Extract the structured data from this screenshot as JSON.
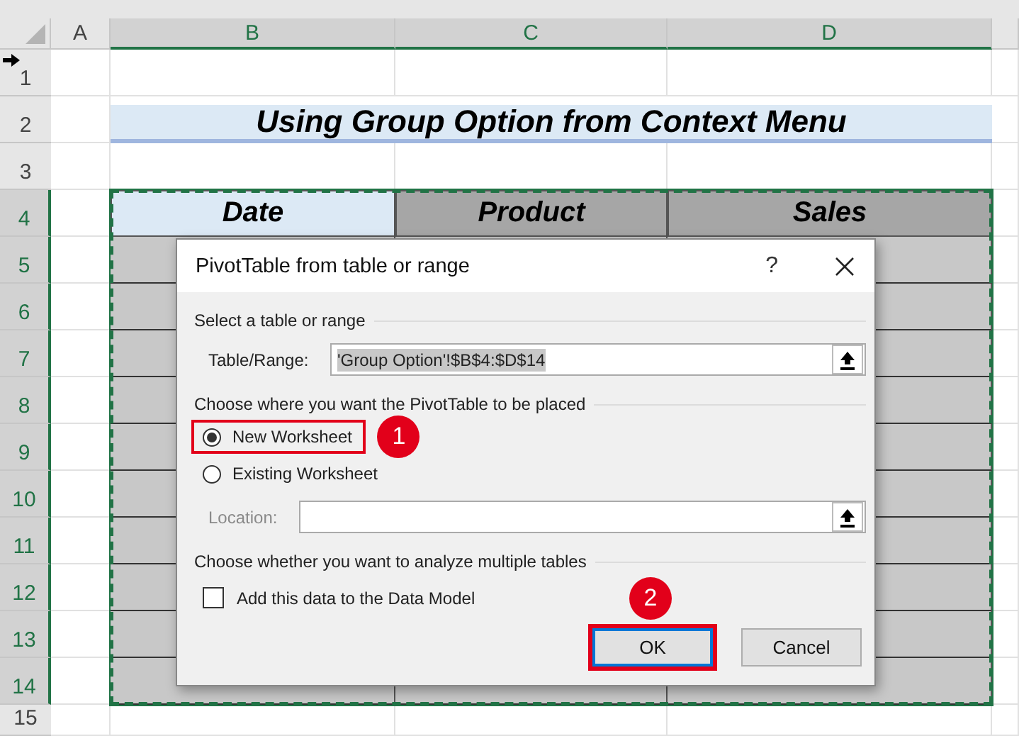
{
  "sheet": {
    "columns": [
      {
        "label": "A",
        "selected": false
      },
      {
        "label": "B",
        "selected": true
      },
      {
        "label": "C",
        "selected": true
      },
      {
        "label": "D",
        "selected": true
      }
    ],
    "rows": [
      {
        "label": "1",
        "selected": false
      },
      {
        "label": "2",
        "selected": false
      },
      {
        "label": "3",
        "selected": false
      },
      {
        "label": "4",
        "selected": true
      },
      {
        "label": "5",
        "selected": true
      },
      {
        "label": "6",
        "selected": true
      },
      {
        "label": "7",
        "selected": true
      },
      {
        "label": "8",
        "selected": true
      },
      {
        "label": "9",
        "selected": true
      },
      {
        "label": "10",
        "selected": true
      },
      {
        "label": "11",
        "selected": true
      },
      {
        "label": "12",
        "selected": true
      },
      {
        "label": "13",
        "selected": true
      },
      {
        "label": "14",
        "selected": true
      },
      {
        "label": "15",
        "selected": false
      }
    ],
    "title": "Using Group Option from Context Menu",
    "table_headers": [
      {
        "label": "Date",
        "selected": true
      },
      {
        "label": "Product",
        "selected": false
      },
      {
        "label": "Sales",
        "selected": false
      }
    ]
  },
  "dialog": {
    "title": "PivotTable from table or range",
    "help": "?",
    "sections": [
      {
        "heading": "Select a table or range",
        "items": [
          {
            "kind": "field",
            "label": "Table/Range:",
            "value": "'Group Option'!$B$4:$D$14",
            "disabled": false
          }
        ]
      },
      {
        "heading": "Choose where you want the PivotTable to be placed",
        "items": [
          {
            "kind": "radio",
            "label": "New Worksheet",
            "selected": true,
            "highlighted": true,
            "callout": "1"
          },
          {
            "kind": "radio",
            "label": "Existing Worksheet",
            "selected": false,
            "highlighted": false
          },
          {
            "kind": "field",
            "label": "Location:",
            "disabled": true
          }
        ]
      },
      {
        "heading": "Choose whether you want to analyze multiple tables",
        "items": [
          {
            "kind": "checkbox",
            "label": "Add this data to the Data Model",
            "checked": false
          }
        ]
      }
    ],
    "buttons": [
      {
        "label": "OK",
        "default": true,
        "highlighted": true,
        "callout": "2"
      },
      {
        "label": "Cancel",
        "default": false,
        "highlighted": false
      }
    ]
  }
}
